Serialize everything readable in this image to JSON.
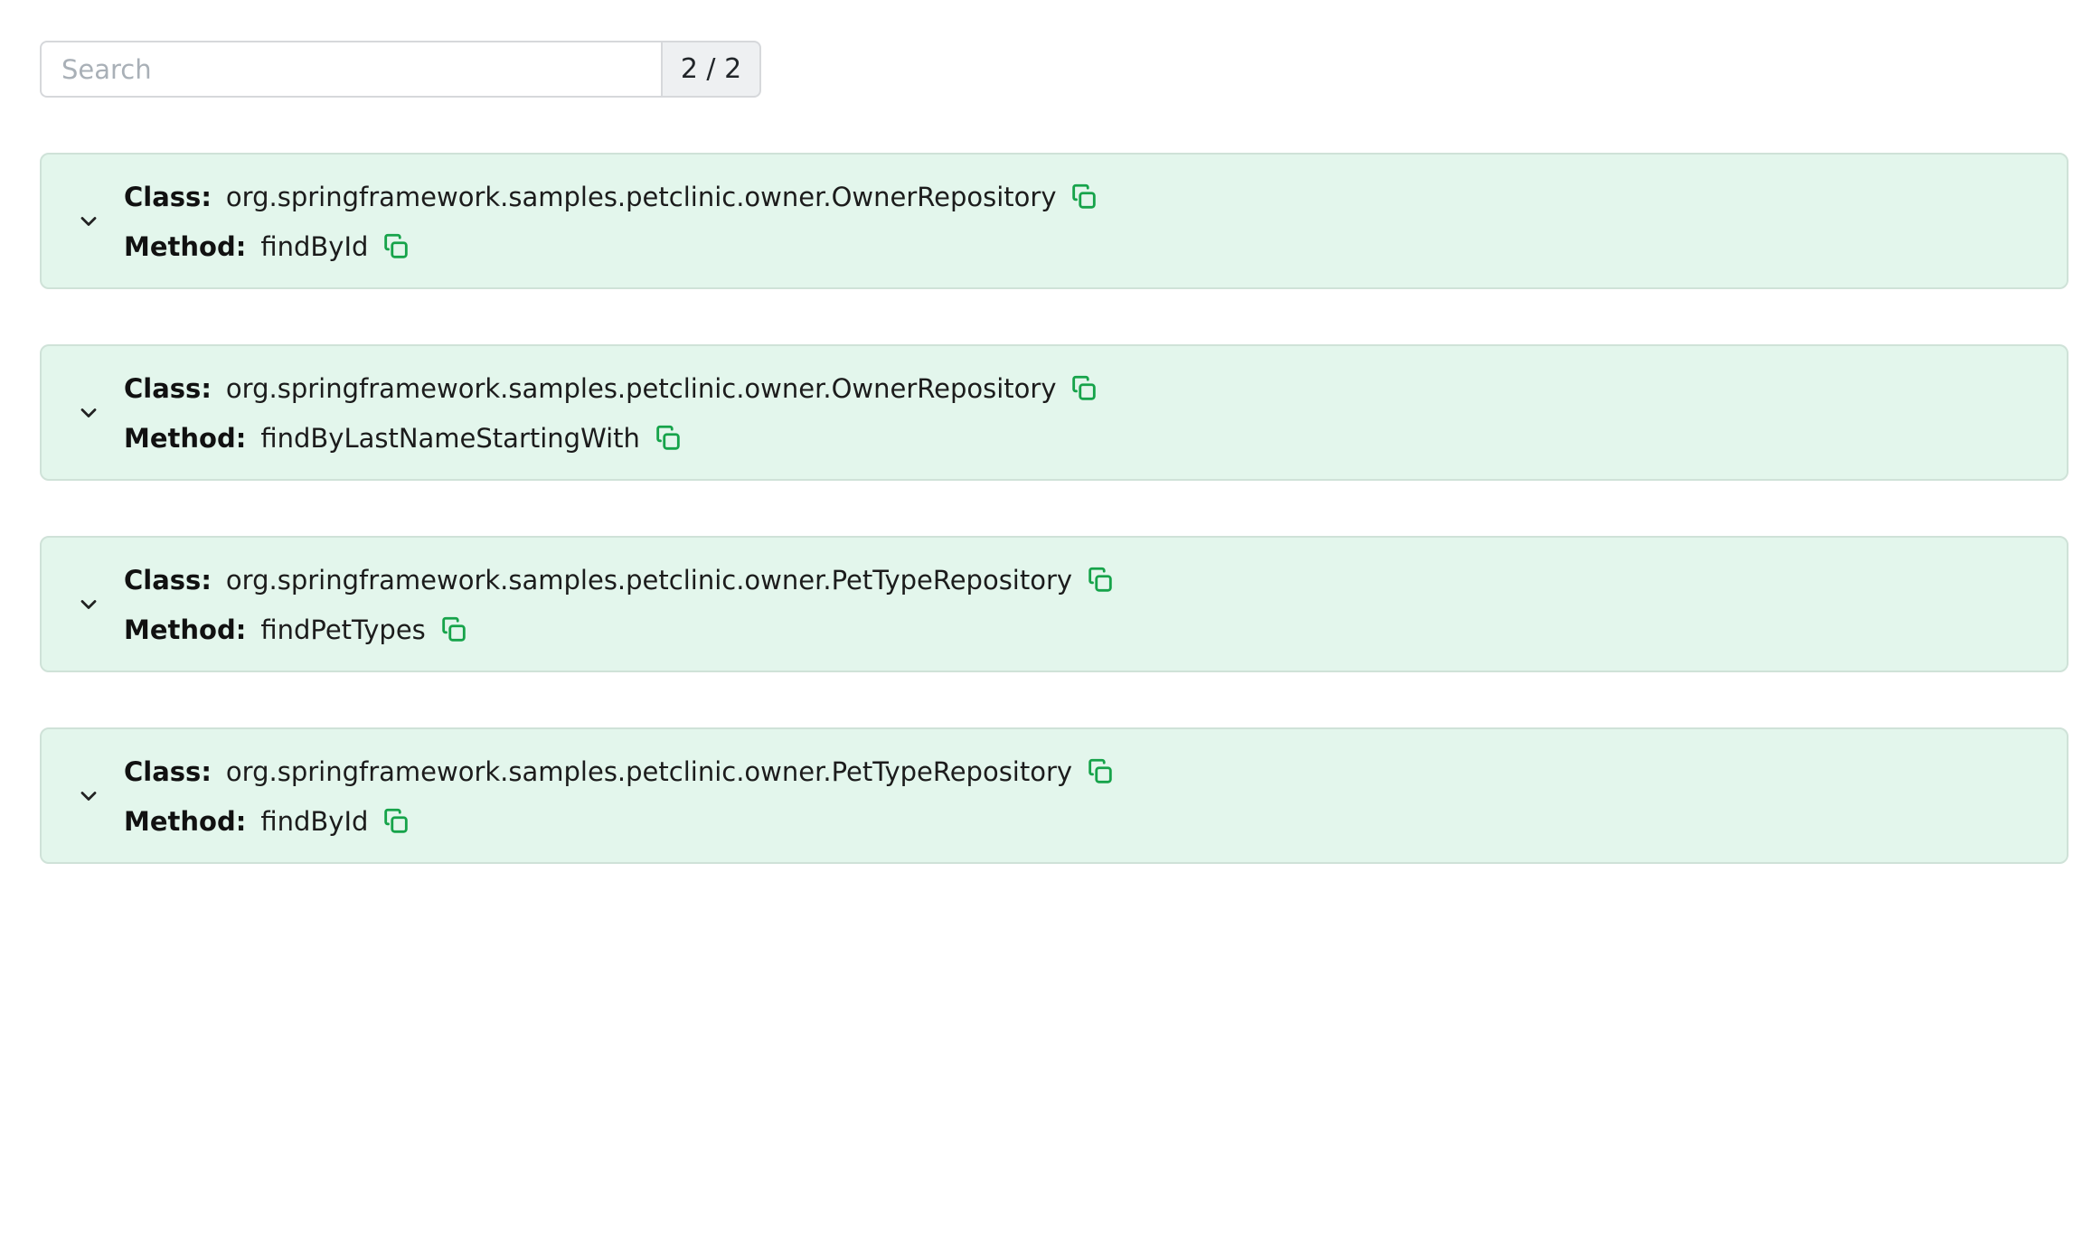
{
  "search": {
    "placeholder": "Search",
    "value": "",
    "counter": "2 / 2"
  },
  "labels": {
    "class": "Class:",
    "method": "Method:"
  },
  "icons": {
    "expand": "chevron-down-icon",
    "copy": "copy-icon"
  },
  "colors": {
    "card_background": "#e3f6ec",
    "card_border": "#cfe2d8",
    "accent": "#16a34a"
  },
  "results": [
    {
      "class": "org.springframework.samples.petclinic.owner.OwnerRepository",
      "method": "findById"
    },
    {
      "class": "org.springframework.samples.petclinic.owner.OwnerRepository",
      "method": "findByLastNameStartingWith"
    },
    {
      "class": "org.springframework.samples.petclinic.owner.PetTypeRepository",
      "method": "findPetTypes"
    },
    {
      "class": "org.springframework.samples.petclinic.owner.PetTypeRepository",
      "method": "findById"
    }
  ]
}
